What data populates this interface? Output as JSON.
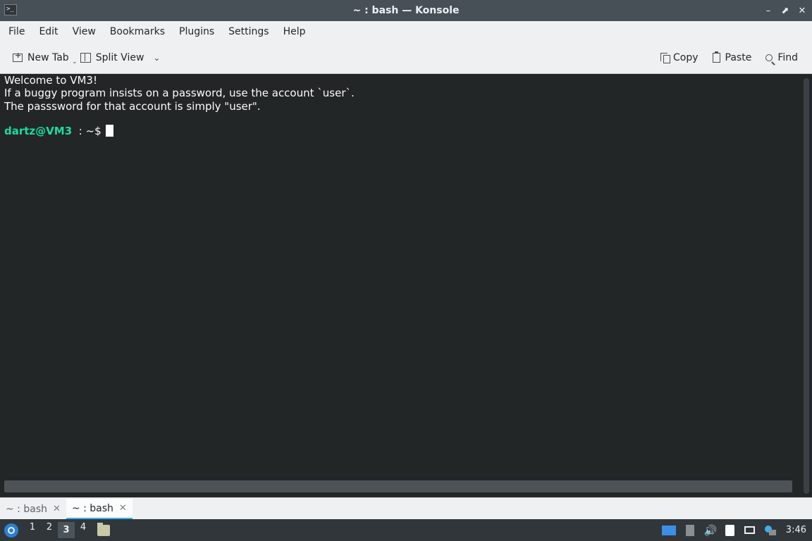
{
  "window": {
    "title": "~ : bash — Konsole",
    "app_icon_glyph": ">_",
    "controls": {
      "minimize": "–",
      "maximize": "⬈",
      "close": "✕"
    }
  },
  "menu": [
    "File",
    "Edit",
    "View",
    "Bookmarks",
    "Plugins",
    "Settings",
    "Help"
  ],
  "toolbar": {
    "new_tab": "New Tab",
    "split_view": "Split View",
    "copy": "Copy",
    "paste": "Paste",
    "find": "Find"
  },
  "terminal": {
    "lines": [
      "Welcome to VM3!",
      "If a buggy program insists on a password, use the account `user`.",
      "The passsword for that account is simply \"user\"."
    ],
    "prompt_user": "dartz@VM3",
    "prompt_sep": "  : ~$",
    "colors": {
      "background": "#232627",
      "prompt_user": "#1cdc9a",
      "text": "#fcfcfc"
    }
  },
  "tabs": [
    {
      "label": "~ : bash",
      "active": false
    },
    {
      "label": "~ : bash",
      "active": true
    }
  ],
  "panel": {
    "desktops": [
      "1",
      "2",
      "3",
      "4"
    ],
    "active_desktop": "3",
    "clock": "3:46"
  }
}
